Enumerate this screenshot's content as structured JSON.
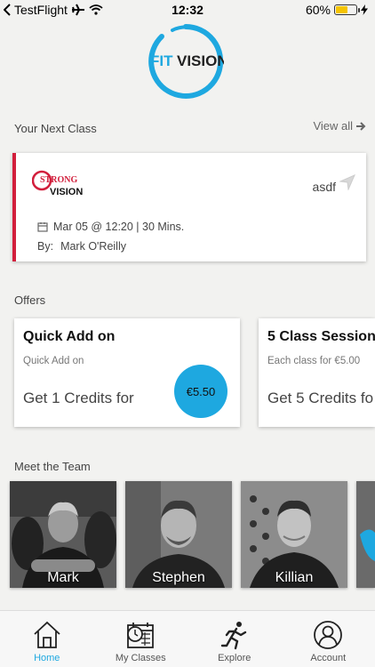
{
  "status_bar": {
    "back_app": "TestFlight",
    "time": "12:32",
    "battery_percent": "60%",
    "battery_level": 0.6
  },
  "brand": {
    "logo_text_fit": "FIT",
    "logo_text_vision": "VISION"
  },
  "next_class": {
    "section_title": "Your Next Class",
    "view_all": "View all",
    "card": {
      "logo_line1": "STRONG",
      "logo_line2": "VISION",
      "class_name": "asdf",
      "when": "Mar 05 @ 12:20 | 30 Mins.",
      "by_label": "By:",
      "instructor": "Mark O'Reilly",
      "accent_color": "#d21f3c"
    }
  },
  "offers": {
    "section_title": "Offers",
    "items": [
      {
        "title": "Quick Add on",
        "subtitle": "Quick Add on",
        "credits": "Get 1 Credits for",
        "price": "€5.50"
      },
      {
        "title": "5 Class Session",
        "subtitle": "Each class for €5.00",
        "credits": "Get 5 Credits fo"
      }
    ]
  },
  "team": {
    "section_title": "Meet the Team",
    "members": [
      {
        "name": "Mark"
      },
      {
        "name": "Stephen"
      },
      {
        "name": "Killian"
      }
    ]
  },
  "tabs": [
    {
      "label": "Home",
      "icon": "home-icon",
      "active": true
    },
    {
      "label": "My Classes",
      "icon": "calendar-clock-icon",
      "active": false
    },
    {
      "label": "Explore",
      "icon": "runner-icon",
      "active": false
    },
    {
      "label": "Account",
      "icon": "user-circle-icon",
      "active": false
    }
  ],
  "colors": {
    "accent": "#1ea8e0",
    "class_accent": "#d21f3c",
    "background": "#f2f2f0"
  }
}
